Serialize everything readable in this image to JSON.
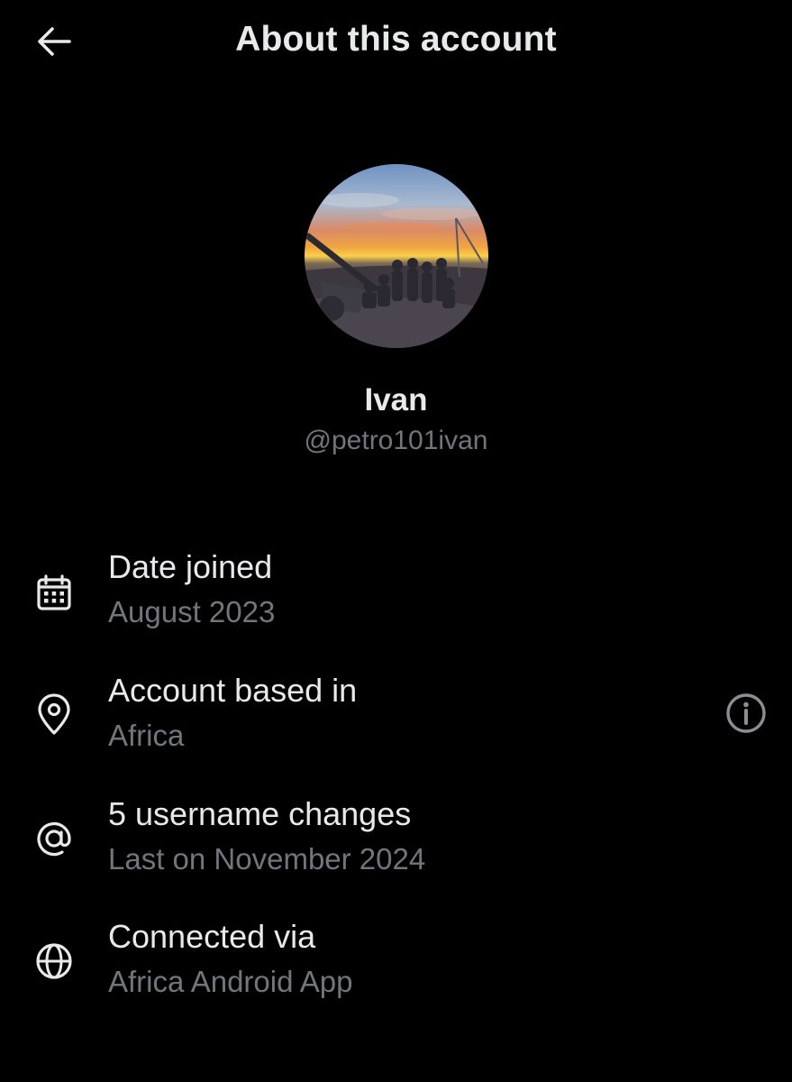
{
  "header": {
    "title": "About this account",
    "back_icon": "arrow-left-icon"
  },
  "profile": {
    "display_name": "Ivan",
    "handle": "@petro101ivan",
    "avatar": "sunset-group-photo"
  },
  "rows": [
    {
      "icon": "calendar-icon",
      "title": "Date joined",
      "subtitle": "August 2023"
    },
    {
      "icon": "location-pin-icon",
      "title": "Account based in",
      "subtitle": "Africa",
      "action_icon": "info-icon"
    },
    {
      "icon": "at-sign-icon",
      "title": "5 username changes",
      "subtitle": "Last on November 2024"
    },
    {
      "icon": "globe-icon",
      "title": "Connected via",
      "subtitle": "Africa Android App"
    }
  ],
  "colors": {
    "background": "#000000",
    "primary_text": "#e7e9ea",
    "secondary_text": "#71767b"
  }
}
